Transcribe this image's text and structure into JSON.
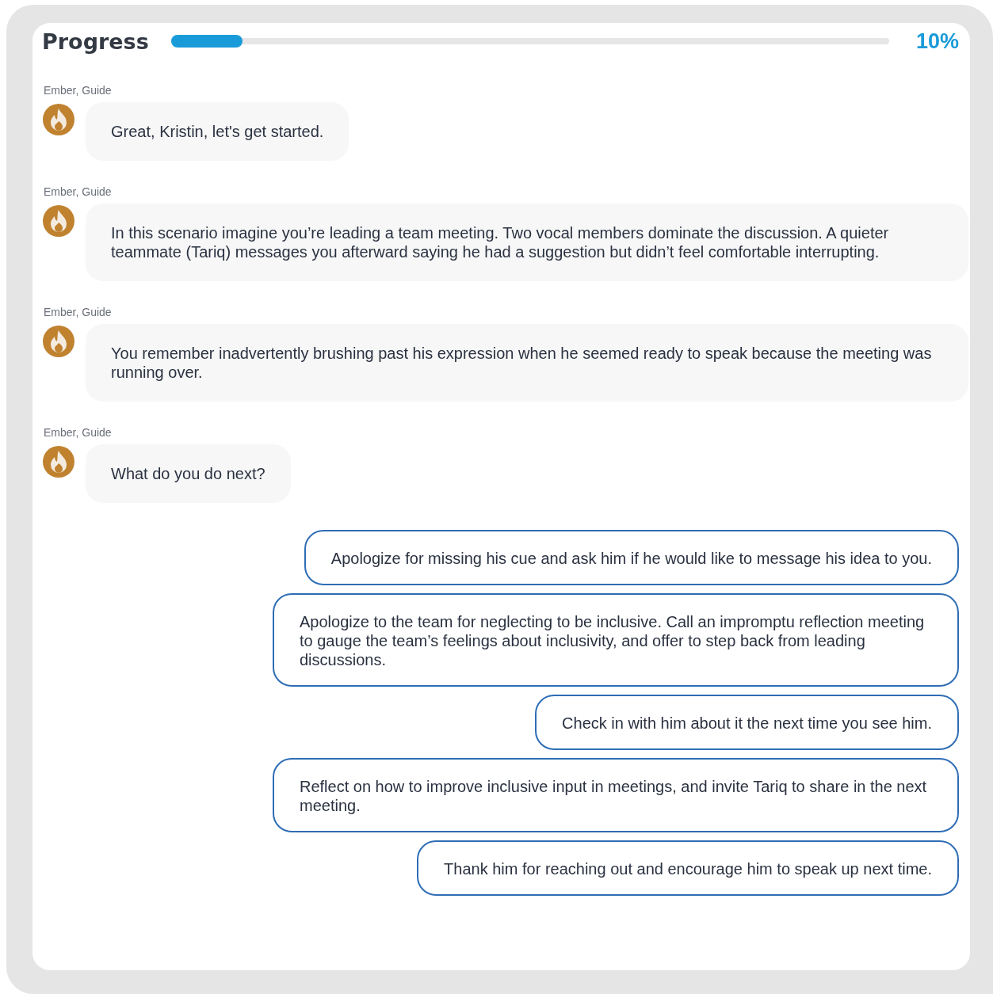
{
  "progress": {
    "label": "Progress",
    "level": 0.1,
    "reading": "10%"
  },
  "messages": [
    {
      "sender": "Ember, Guide",
      "text": "Great, Kristin, let's get started."
    },
    {
      "sender": "Ember, Guide",
      "text": "In this scenario imagine you’re leading a team meeting. Two vocal members dominate the discussion. A quieter teammate (Tariq) messages you afterward saying he had a suggestion but didn’t feel comfortable interrupting."
    },
    {
      "sender": "Ember, Guide",
      "text": "You remember inadvertently brushing past his expression when he seemed ready to speak because the meeting was running over."
    },
    {
      "sender": "Ember, Guide",
      "text": "What do you do next?"
    }
  ],
  "choices": [
    "Apologize for missing his cue and ask him if he would like to message his idea to you.",
    "Apologize to the team for neglecting to be inclusive. Call an impromptu reflection meeting to gauge the team’s feelings about inclusivity, and offer to step back from leading discussions.",
    "Check in with him about it the next time you see him.",
    "Reflect on how to improve inclusive input in meetings, and invite Tariq to share in the next meeting.",
    "Thank him for reaching out and encourage him to speak up next time."
  ]
}
